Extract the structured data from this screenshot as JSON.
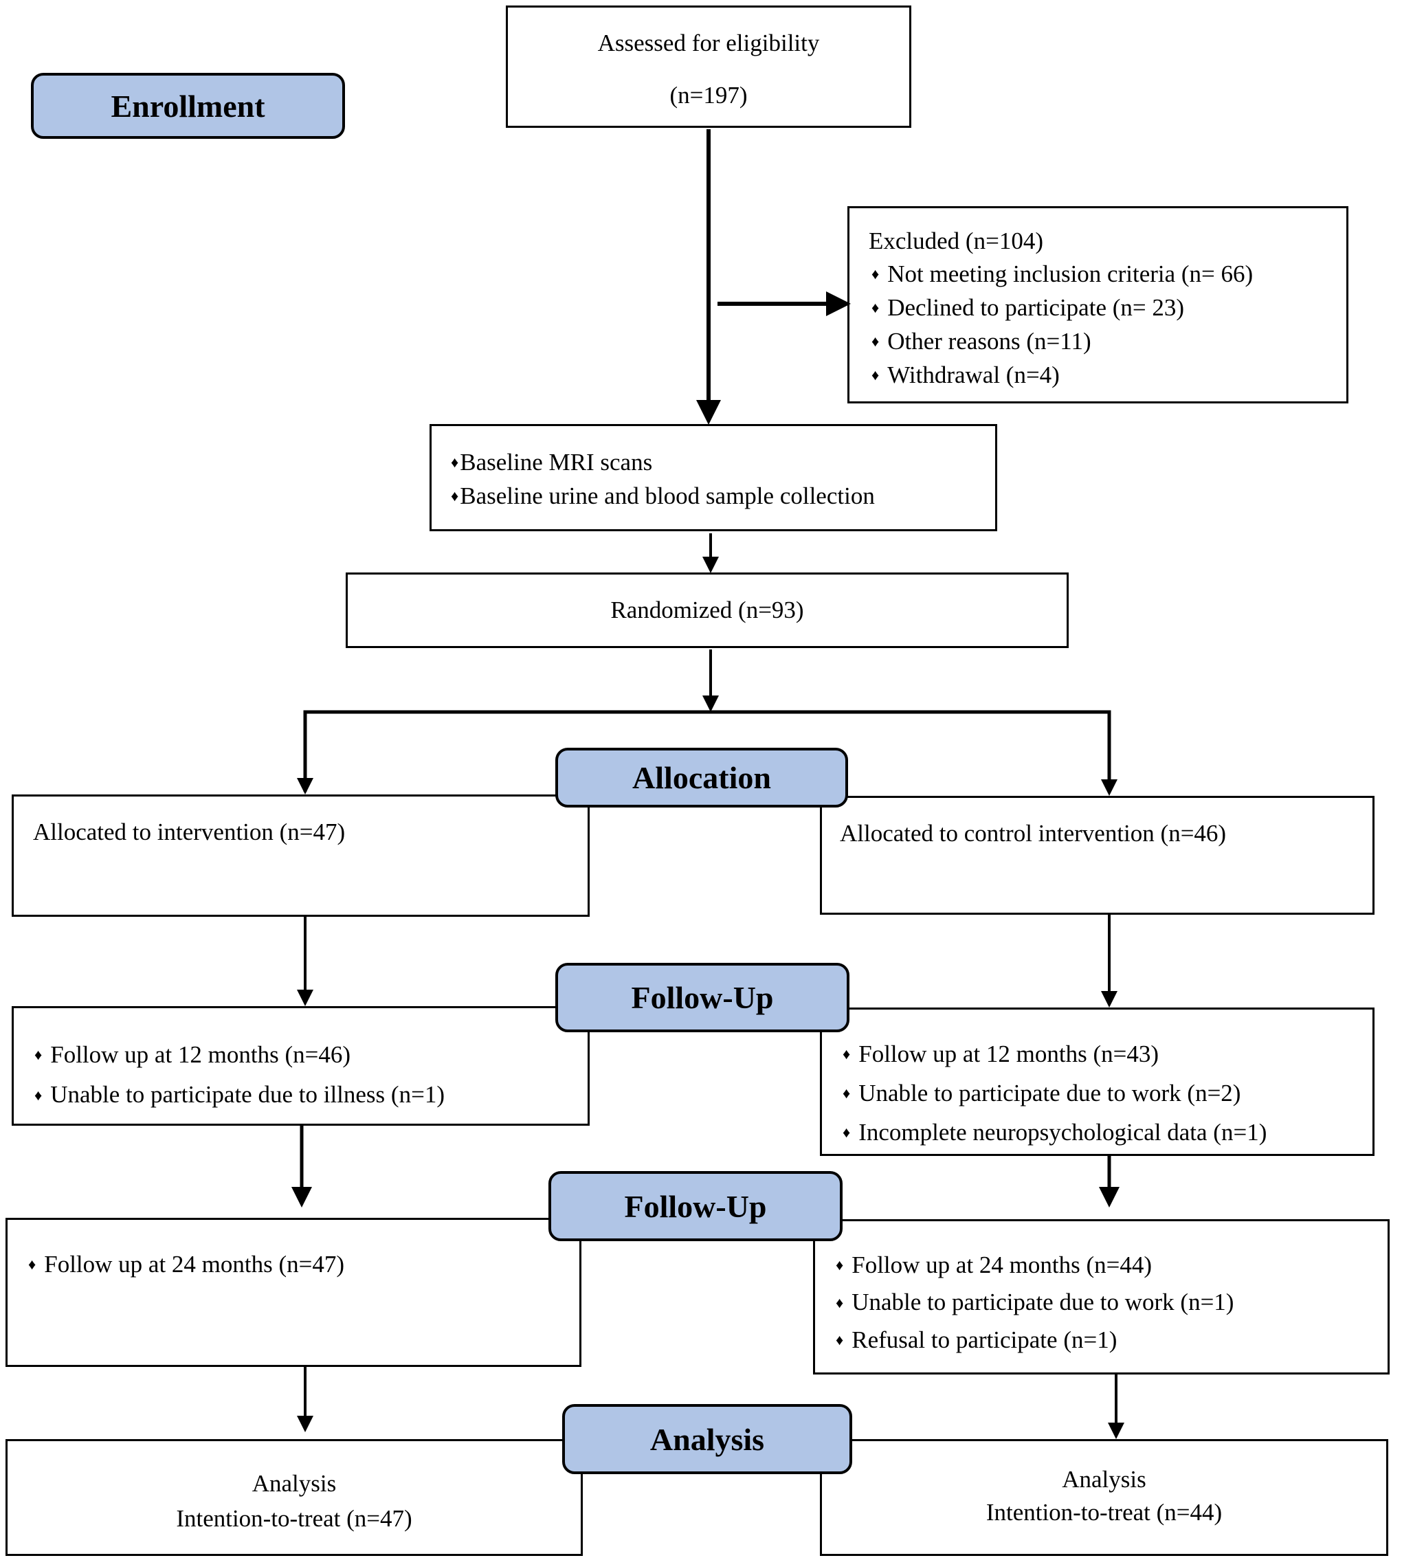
{
  "stages": {
    "enrollment": "Enrollment",
    "allocation": "Allocation",
    "follow_up_1": "Follow-Up",
    "follow_up_2": "Follow-Up",
    "analysis": "Analysis"
  },
  "assessed": {
    "title": "Assessed for eligibility",
    "count": "(n=197)"
  },
  "excluded": {
    "title": "Excluded (n=104)",
    "items": [
      "Not meeting inclusion criteria (n= 66)",
      "Declined to participate (n= 23)",
      "Other reasons (n=11)",
      "Withdrawal (n=4)"
    ]
  },
  "baseline": {
    "items": [
      "Baseline MRI scans",
      "Baseline urine and blood sample collection"
    ]
  },
  "randomized": "Randomized (n=93)",
  "allocation": {
    "intervention": "Allocated to intervention (n=47)",
    "control": "Allocated to control intervention (n=46)"
  },
  "follow_up_12": {
    "intervention": [
      "Follow up at 12 months (n=46)",
      "Unable to participate due to illness (n=1)"
    ],
    "control": [
      "Follow up at 12 months (n=43)",
      "Unable to participate due to work (n=2)",
      "Incomplete neuropsychological data (n=1)"
    ]
  },
  "follow_up_24": {
    "intervention": [
      "Follow up at 24 months (n=47)"
    ],
    "control": [
      "Follow up at 24 months (n=44)",
      "Unable to participate due to work (n=1)",
      "Refusal to participate (n=1)"
    ]
  },
  "analysis": {
    "intervention": {
      "title": "Analysis",
      "detail": "Intention-to-treat (n=47)"
    },
    "control": {
      "title": "Analysis",
      "detail": "Intention-to-treat (n=44)"
    }
  },
  "colors": {
    "stage_fill": "#b0c5e6",
    "stroke": "#000000"
  },
  "bullet_glyph": "♦"
}
